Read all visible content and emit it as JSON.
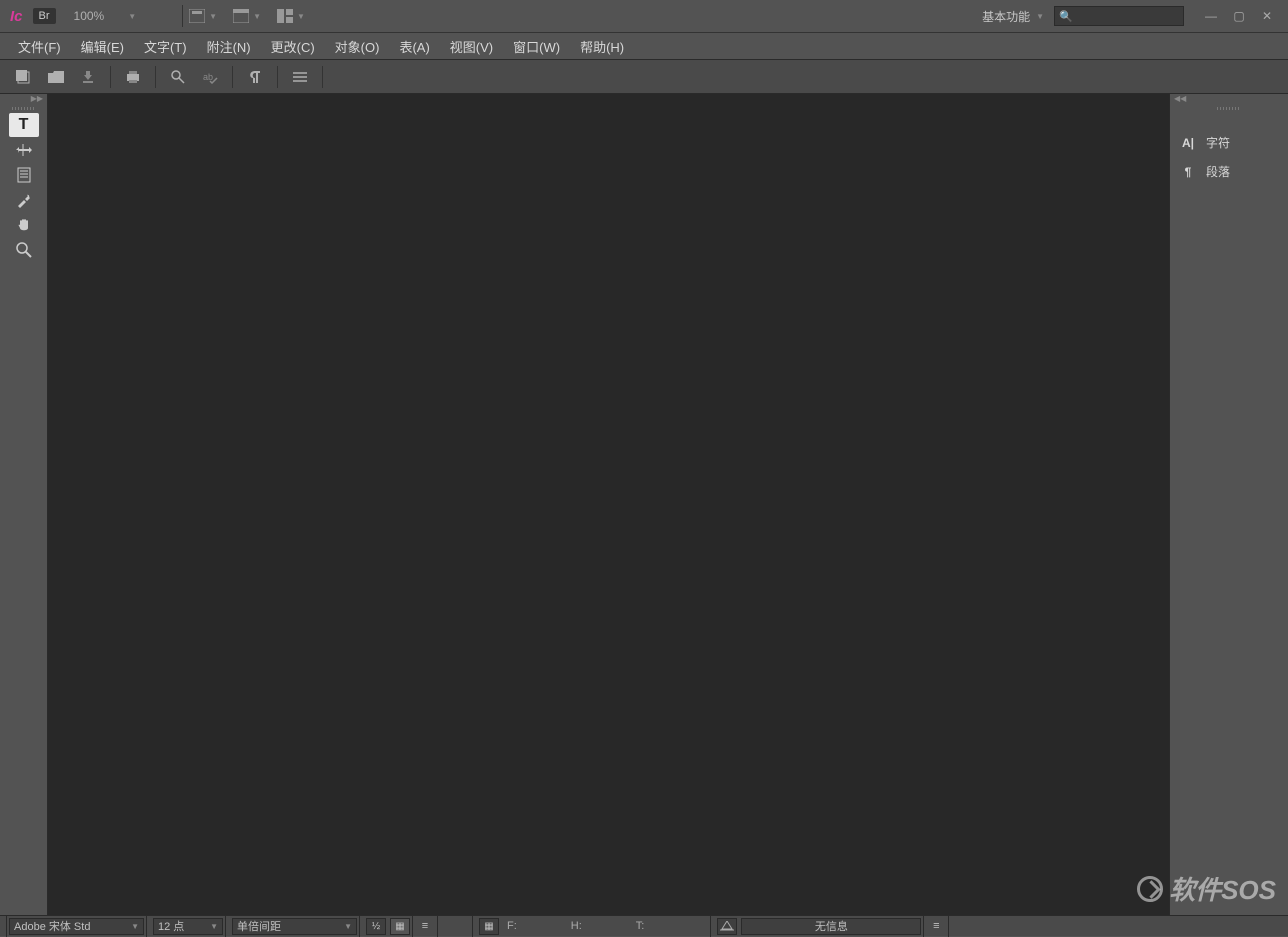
{
  "titlebar": {
    "app_logo": "Ic",
    "bridge_btn": "Br",
    "zoom": "100%",
    "workspace": "基本功能",
    "search_placeholder": ""
  },
  "menubar": [
    "文件(F)",
    "编辑(E)",
    "文字(T)",
    "附注(N)",
    "更改(C)",
    "对象(O)",
    "表(A)",
    "视图(V)",
    "窗口(W)",
    "帮助(H)"
  ],
  "right_panel": {
    "items": [
      "字符",
      "段落"
    ]
  },
  "statusbar": {
    "font": "Adobe 宋体 Std",
    "size": "12 点",
    "spacing": "单倍间距",
    "labels": {
      "f": "F:",
      "h": "H:",
      "t": "T:"
    },
    "info": "无信息"
  },
  "watermark": "软件SOS"
}
